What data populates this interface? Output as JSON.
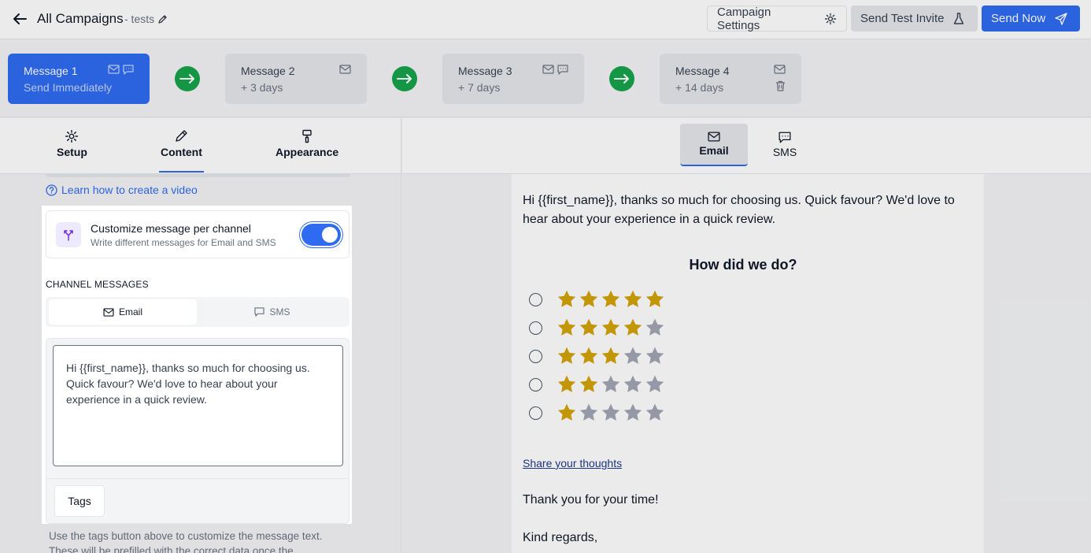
{
  "header": {
    "title": "All Campaigns",
    "subtitle": "- tests",
    "campaign_settings_label": "Campaign Settings",
    "send_test_label": "Send Test Invite",
    "send_now_label": "Send Now"
  },
  "messages": [
    {
      "title": "Message 1",
      "timing": "Send Immediately"
    },
    {
      "title": "Message 2",
      "timing": "+ 3 days"
    },
    {
      "title": "Message 3",
      "timing": "+ 7 days"
    },
    {
      "title": "Message 4",
      "timing": "+ 14 days"
    }
  ],
  "left_tabs": {
    "setup": "Setup",
    "content": "Content",
    "appearance": "Appearance"
  },
  "learn_link": "Learn how to create a video",
  "customize": {
    "title": "Customize message per channel",
    "subtitle": "Write different messages for Email and SMS",
    "enabled": true
  },
  "channel_messages": {
    "label": "CHANNEL MESSAGES",
    "email_tab": "Email",
    "sms_tab": "SMS",
    "text": "Hi {{first_name}}, thanks so much for choosing us. Quick favour? We'd love to hear about your experience in a quick review.",
    "tags_label": "Tags"
  },
  "help_text": "Use the tags button above to customize the message text. These will be prefilled with the correct data once the",
  "right_tabs": {
    "email": "Email",
    "sms": "SMS"
  },
  "preview": {
    "intro": "Hi {{first_name}}, thanks so much for choosing us. Quick favour? We'd love to hear about your experience in a quick review.",
    "heading": "How did we do?",
    "ratings": [
      5,
      4,
      3,
      2,
      1
    ],
    "link": "Share your thoughts",
    "thanks": "Thank you for your time!",
    "regards": "Kind regards,"
  },
  "colors": {
    "primary": "#2f6bf0",
    "success": "#16a34a",
    "star_filled": "#d4a306",
    "star_empty": "#a1a7b3"
  }
}
